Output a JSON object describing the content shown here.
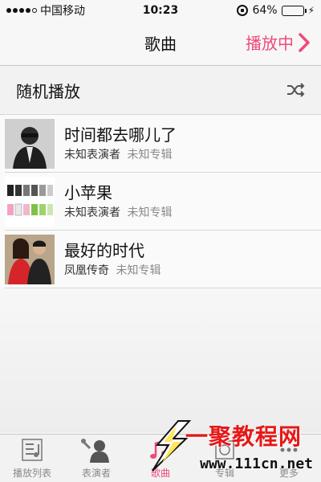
{
  "status_bar": {
    "carrier": "中国移动",
    "time": "10:23",
    "battery_percent": "64%",
    "battery_level": 0.64
  },
  "nav": {
    "title": "歌曲",
    "now_playing": "播放中"
  },
  "shuffle": {
    "label": "随机播放",
    "icon": "shuffle-icon"
  },
  "songs": [
    {
      "title": "时间都去哪儿了",
      "artist": "未知表演者",
      "album": "未知专辑"
    },
    {
      "title": "小苹果",
      "artist": "未知表演者",
      "album": "未知专辑"
    },
    {
      "title": "最好的时代",
      "artist": "凤凰传奇",
      "album": "未知专辑"
    }
  ],
  "tabs": [
    {
      "label": "播放列表",
      "icon": "playlist-icon",
      "active": false
    },
    {
      "label": "表演者",
      "icon": "artist-icon",
      "active": false
    },
    {
      "label": "歌曲",
      "icon": "song-icon",
      "active": true
    },
    {
      "label": "专辑",
      "icon": "album-icon",
      "active": false
    },
    {
      "label": "更多",
      "icon": "more-icon",
      "active": false
    }
  ],
  "watermark": {
    "main": "一聚教程网",
    "url": "www.111cn.net"
  },
  "colors": {
    "accent": "#ef4a79",
    "battery": "#4cd964",
    "watermark": "#e61818"
  }
}
